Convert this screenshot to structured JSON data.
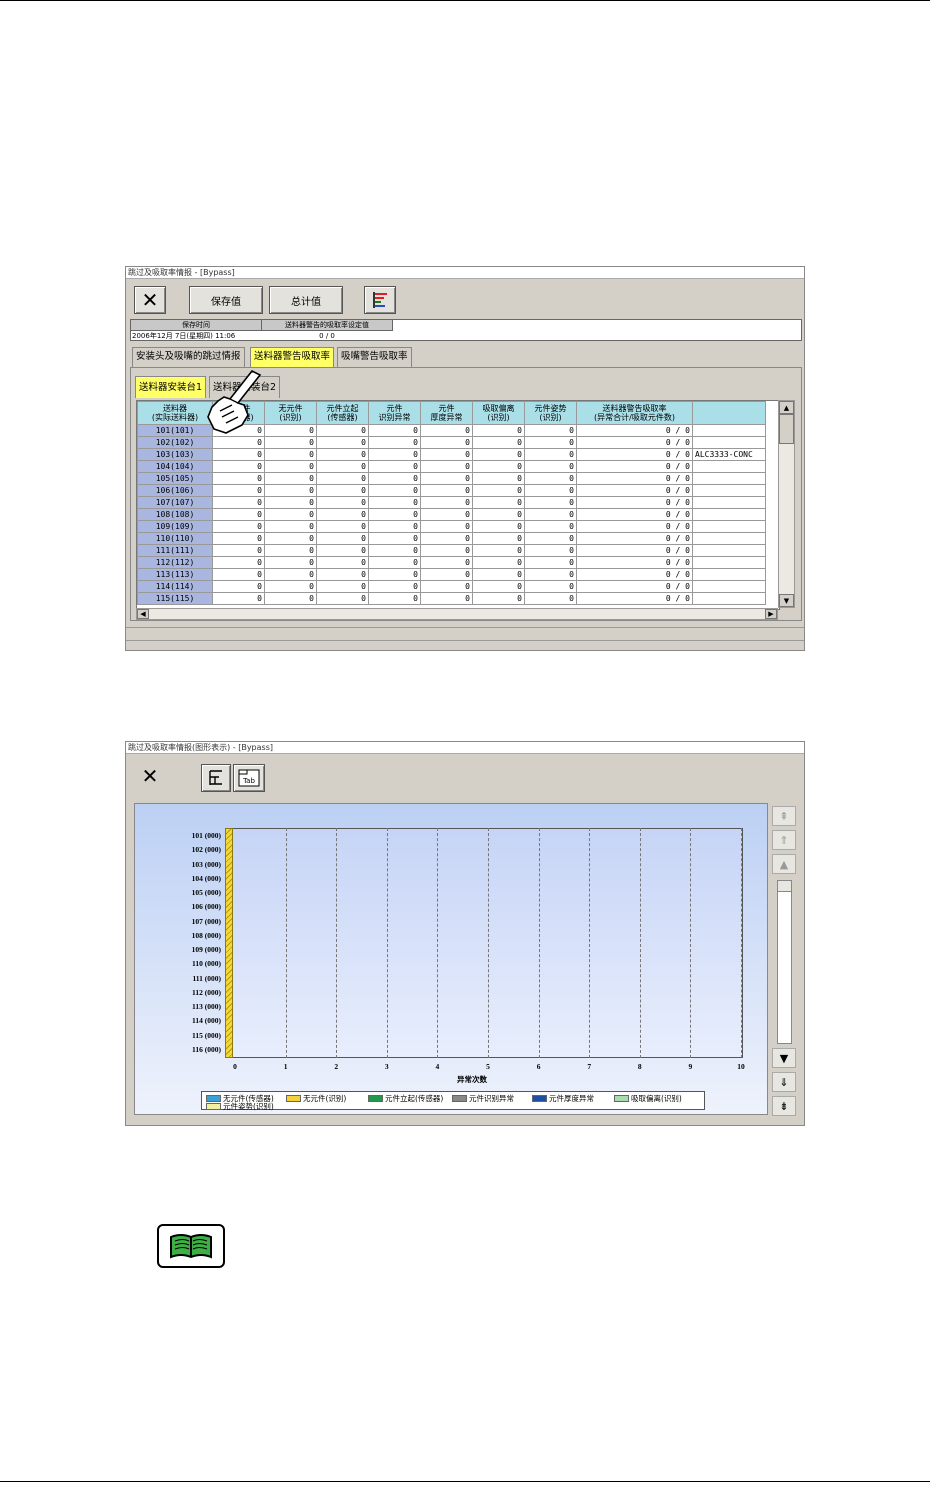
{
  "window1": {
    "title": "跳过及吸取率情报 - [Bypass]",
    "buttons": {
      "save": "保存值",
      "total": "总计值"
    },
    "info": {
      "col1_header": "保存时间",
      "col2_header": "送料器警告的吸取率设定值",
      "col1_value": "2006年12月 7日(星期四) 11:06",
      "col2_value": "0 / 0"
    },
    "tabs": [
      "安装头及吸嘴的跳过情报",
      "送料器警告吸取率",
      "吸嘴警告吸取率"
    ],
    "subtabs": [
      "送料器安装台1",
      "送料器安装台2"
    ],
    "columns": [
      "送料器\n(实际送料器)",
      "无元件\n(传感器)",
      "无元件\n(识别)",
      "元件立起\n(传感器)",
      "元件\n识别异常",
      "元件\n厚度异常",
      "吸取偏离\n(识别)",
      "元件姿势\n(识别)",
      "送料器警告吸取率\n(异常合计/吸取元件数)",
      ""
    ],
    "rows": [
      [
        "101(101)",
        "0",
        "0",
        "0",
        "0",
        "0",
        "0",
        "0",
        "0 / 0",
        ""
      ],
      [
        "102(102)",
        "0",
        "0",
        "0",
        "0",
        "0",
        "0",
        "0",
        "0 / 0",
        ""
      ],
      [
        "103(103)",
        "0",
        "0",
        "0",
        "0",
        "0",
        "0",
        "0",
        "0 / 0",
        "ALC3333-CONC"
      ],
      [
        "104(104)",
        "0",
        "0",
        "0",
        "0",
        "0",
        "0",
        "0",
        "0 / 0",
        ""
      ],
      [
        "105(105)",
        "0",
        "0",
        "0",
        "0",
        "0",
        "0",
        "0",
        "0 / 0",
        ""
      ],
      [
        "106(106)",
        "0",
        "0",
        "0",
        "0",
        "0",
        "0",
        "0",
        "0 / 0",
        ""
      ],
      [
        "107(107)",
        "0",
        "0",
        "0",
        "0",
        "0",
        "0",
        "0",
        "0 / 0",
        ""
      ],
      [
        "108(108)",
        "0",
        "0",
        "0",
        "0",
        "0",
        "0",
        "0",
        "0 / 0",
        ""
      ],
      [
        "109(109)",
        "0",
        "0",
        "0",
        "0",
        "0",
        "0",
        "0",
        "0 / 0",
        ""
      ],
      [
        "110(110)",
        "0",
        "0",
        "0",
        "0",
        "0",
        "0",
        "0",
        "0 / 0",
        ""
      ],
      [
        "111(111)",
        "0",
        "0",
        "0",
        "0",
        "0",
        "0",
        "0",
        "0 / 0",
        ""
      ],
      [
        "112(112)",
        "0",
        "0",
        "0",
        "0",
        "0",
        "0",
        "0",
        "0 / 0",
        ""
      ],
      [
        "113(113)",
        "0",
        "0",
        "0",
        "0",
        "0",
        "0",
        "0",
        "0 / 0",
        ""
      ],
      [
        "114(114)",
        "0",
        "0",
        "0",
        "0",
        "0",
        "0",
        "0",
        "0 / 0",
        ""
      ],
      [
        "115(115)",
        "0",
        "0",
        "0",
        "0",
        "0",
        "0",
        "0",
        "0 / 0",
        ""
      ]
    ]
  },
  "window2": {
    "title": "跳过及吸取率情报(图形表示) - [Bypass]",
    "tab_icon_label": "Tab"
  },
  "chart_data": {
    "type": "bar",
    "orientation": "horizontal",
    "stacked": true,
    "categories": [
      "101 (000)",
      "102 (000)",
      "103 (000)",
      "104 (000)",
      "105 (000)",
      "106 (000)",
      "107 (000)",
      "108 (000)",
      "109 (000)",
      "110 (000)",
      "111 (000)",
      "112 (000)",
      "113 (000)",
      "114 (000)",
      "115 (000)",
      "116 (000)"
    ],
    "xlabel": "异常次数",
    "ylabel": "",
    "xlim": [
      0,
      10
    ],
    "xticks": [
      "0",
      "1",
      "2",
      "3",
      "4",
      "5",
      "6",
      "7",
      "8",
      "9",
      "10"
    ],
    "grid": "vertical dashed",
    "legend_position": "bottom",
    "series": [
      {
        "name": "无元件(传感器)",
        "color": "#3aa0d8",
        "values": [
          0,
          0,
          0,
          0,
          0,
          0,
          0,
          0,
          0,
          0,
          0,
          0,
          0,
          0,
          0,
          0
        ]
      },
      {
        "name": "无元件(识别)",
        "color": "#f2d13a",
        "values": [
          0,
          0,
          0,
          0,
          0,
          0,
          0,
          0,
          0,
          0,
          0,
          0,
          0,
          0,
          0,
          0
        ]
      },
      {
        "name": "元件立起(传感器)",
        "color": "#1f9a4a",
        "values": [
          0,
          0,
          0,
          0,
          0,
          0,
          0,
          0,
          0,
          0,
          0,
          0,
          0,
          0,
          0,
          0
        ]
      },
      {
        "name": "元件识别异常",
        "color": "#888888",
        "values": [
          0,
          0,
          0,
          0,
          0,
          0,
          0,
          0,
          0,
          0,
          0,
          0,
          0,
          0,
          0,
          0
        ]
      },
      {
        "name": "元件厚度异常",
        "color": "#1f4fa0",
        "values": [
          0,
          0,
          0,
          0,
          0,
          0,
          0,
          0,
          0,
          0,
          0,
          0,
          0,
          0,
          0,
          0
        ]
      },
      {
        "name": "吸取偏离(识别)",
        "color": "#a8dcb0",
        "values": [
          0,
          0,
          0,
          0,
          0,
          0,
          0,
          0,
          0,
          0,
          0,
          0,
          0,
          0,
          0,
          0
        ]
      },
      {
        "name": "元件姿势(识别)",
        "color": "#f4f0a0",
        "values": [
          0,
          0,
          0,
          0,
          0,
          0,
          0,
          0,
          0,
          0,
          0,
          0,
          0,
          0,
          0,
          0
        ]
      }
    ]
  },
  "colors": {
    "active_tab": "#ffff66",
    "header": "#aadfe8",
    "row_header": "#a9b6e0",
    "plot_bg": "#c9d6f5"
  }
}
